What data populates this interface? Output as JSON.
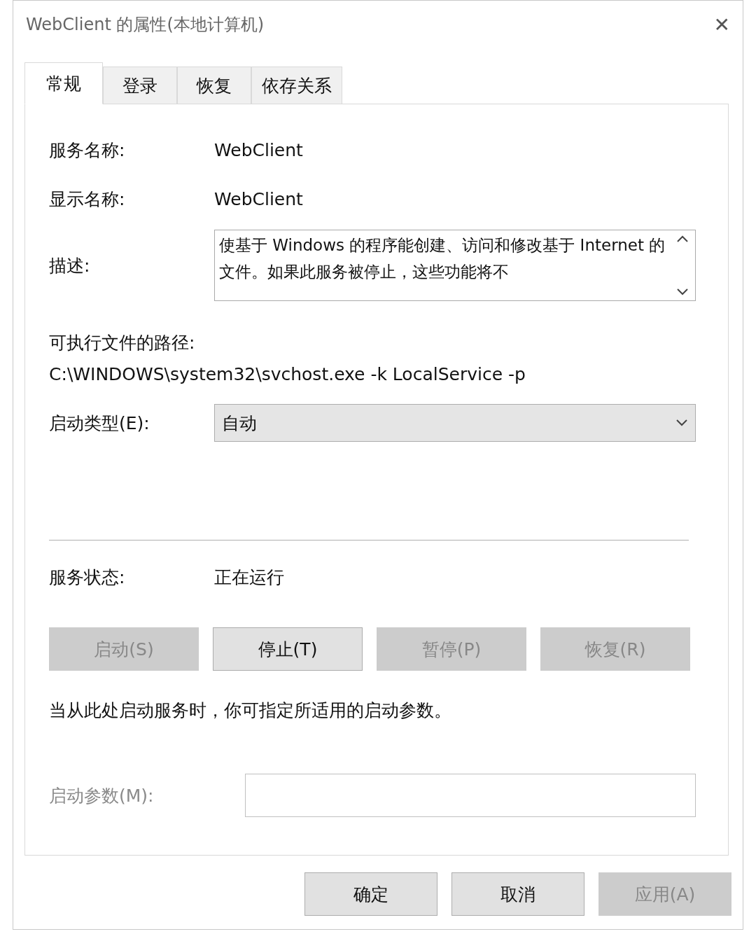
{
  "window": {
    "title": "WebClient 的属性(本地计算机)",
    "close": "✕"
  },
  "tabs": [
    {
      "label": "常规",
      "selected": true
    },
    {
      "label": "登录",
      "selected": false
    },
    {
      "label": "恢复",
      "selected": false
    },
    {
      "label": "依存关系",
      "selected": false
    }
  ],
  "fields": [
    {
      "label": "服务名称:",
      "value": "WebClient"
    },
    {
      "label": "显示名称:",
      "value": "WebClient"
    }
  ],
  "description": {
    "label": "描述:",
    "text": "使基于 Windows 的程序能创建、访问和修改基于 Internet 的文件。如果此服务被停止，这些功能将不"
  },
  "path": {
    "label": "可执行文件的路径:",
    "value": "C:\\WINDOWS\\system32\\svchost.exe -k LocalService -p"
  },
  "startup_type": {
    "label": "启动类型(E):",
    "value": "自动"
  },
  "service_status": {
    "label": "服务状态:",
    "value": "正在运行"
  },
  "service_buttons": [
    {
      "label": "启动(S)",
      "disabled": true
    },
    {
      "label": "停止(T)",
      "disabled": false
    },
    {
      "label": "暂停(P)",
      "disabled": true
    },
    {
      "label": "恢复(R)",
      "disabled": true
    }
  ],
  "hint": "当从此处启动服务时，你可指定所适用的启动参数。",
  "start_params": {
    "label": "启动参数(M):",
    "disabled": true
  },
  "dialog_buttons": [
    {
      "label": "确定",
      "disabled": false
    },
    {
      "label": "取消",
      "disabled": false
    },
    {
      "label": "应用(A)",
      "disabled": true
    }
  ]
}
